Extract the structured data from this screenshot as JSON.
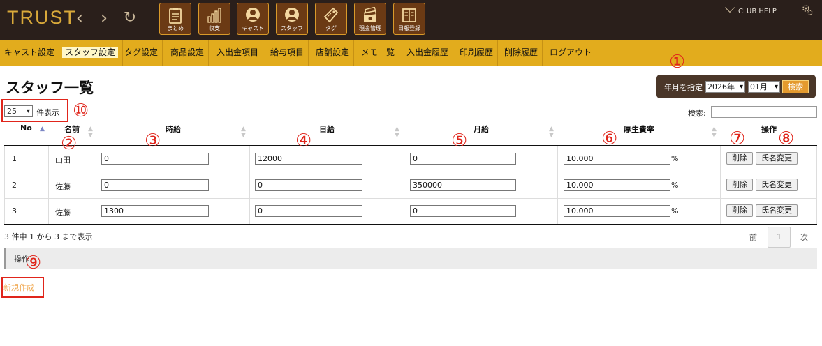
{
  "header": {
    "logo": "TRUST",
    "buttons": [
      {
        "label": "まとめ",
        "icon": "clipboard-icon"
      },
      {
        "label": "収支",
        "icon": "bar-chart-icon"
      },
      {
        "label": "キャスト",
        "icon": "user-icon"
      },
      {
        "label": "スタッフ",
        "icon": "user-icon"
      },
      {
        "label": "タグ",
        "icon": "tag-icon"
      },
      {
        "label": "現金管理",
        "icon": "cash-icon"
      },
      {
        "label": "日報登録",
        "icon": "book-icon"
      }
    ],
    "club_help": "CLUB HELP"
  },
  "menu": [
    "キャスト設定",
    "スタッフ設定",
    "タグ設定",
    "商品設定",
    "入出金項目",
    "給与項目",
    "店舗設定",
    "メモ一覧",
    "入出金履歴",
    "印刷履歴",
    "削除履歴",
    "ログアウト"
  ],
  "page_title": "スタッフ一覧",
  "date_filter": {
    "label": "年月を指定",
    "year": "2026年",
    "month": "01月",
    "search_button": "検索"
  },
  "length_select": {
    "value": "25",
    "suffix": "件表示"
  },
  "search_label": "検索:",
  "table": {
    "headers": [
      "No",
      "名前",
      "時給",
      "日給",
      "月給",
      "厚生費率",
      "操作"
    ],
    "rows": [
      {
        "no": "1",
        "name": "山田",
        "hourly": "0",
        "daily": "12000",
        "monthly": "0",
        "welfare": "10.000"
      },
      {
        "no": "2",
        "name": "佐藤",
        "hourly": "0",
        "daily": "0",
        "monthly": "350000",
        "welfare": "10.000"
      },
      {
        "no": "3",
        "name": "佐藤",
        "hourly": "1300",
        "daily": "0",
        "monthly": "0",
        "welfare": "10.000"
      }
    ],
    "pct": "%",
    "delete_label": "削除",
    "rename_label": "氏名変更"
  },
  "info_text": "3 件中 1 から 3 まで表示",
  "pager": {
    "prev": "前",
    "current": "1",
    "next": "次"
  },
  "ops_label": "操作",
  "new_link": "新規作成",
  "annotations": [
    "①",
    "②",
    "③",
    "④",
    "⑤",
    "⑥",
    "⑦",
    "⑧",
    "⑨",
    "⑩"
  ],
  "colors": {
    "header_bg": "#2a1f1b",
    "menu_bg": "#e2ac1d",
    "accent_red": "#e0251b",
    "link_orange": "#f0a54a"
  }
}
